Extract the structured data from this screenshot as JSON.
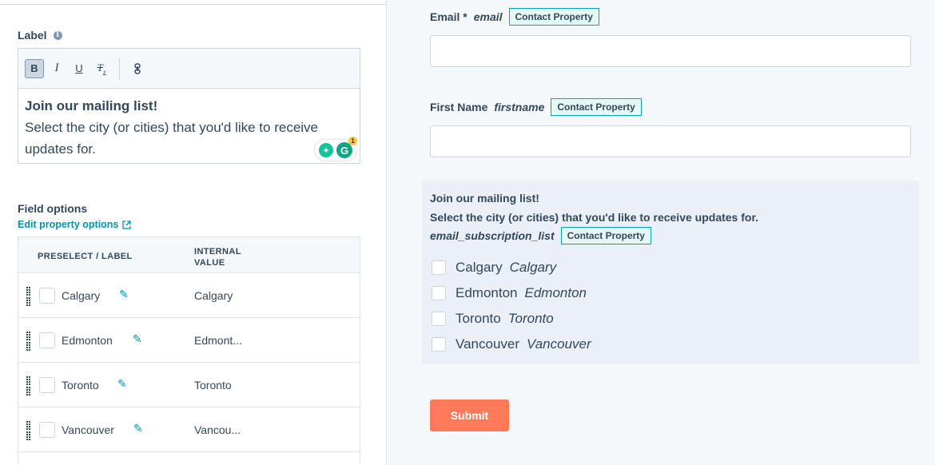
{
  "editor": {
    "label": "Label",
    "toolbar": {
      "bold": "B",
      "italic": "I",
      "underline": "U",
      "clear": "Tx",
      "link": "⛓"
    },
    "heading": "Join our mailing list!",
    "body": "Select the city (or cities) that you'd like to receive updates for.",
    "grammarly_count": "1"
  },
  "field_options": {
    "title": "Field options",
    "edit_link": "Edit property options",
    "columns": {
      "label": "PRESELECT / LABEL",
      "internal": "INTERNAL VALUE"
    },
    "rows": [
      {
        "label": "Calgary",
        "internal": "Calgary"
      },
      {
        "label": "Edmonton",
        "internal": "Edmont..."
      },
      {
        "label": "Toronto",
        "internal": "Toronto"
      },
      {
        "label": "Vancouver",
        "internal": "Vancou..."
      }
    ]
  },
  "preview": {
    "email": {
      "label": "Email *",
      "internal": "email",
      "tag": "Contact Property"
    },
    "firstname": {
      "label": "First Name",
      "internal": "firstname",
      "tag": "Contact Property"
    },
    "subscription": {
      "title": "Join our mailing list!",
      "description": "Select the city (or cities) that you'd like to receive updates for.",
      "internal": "email_subscription_list",
      "tag": "Contact Property",
      "options": [
        {
          "label": "Calgary",
          "internal": "Calgary"
        },
        {
          "label": "Edmonton",
          "internal": "Edmonton"
        },
        {
          "label": "Toronto",
          "internal": "Toronto"
        },
        {
          "label": "Vancouver",
          "internal": "Vancouver"
        }
      ]
    },
    "submit": "Submit"
  },
  "colors": {
    "accent": "#0091ae",
    "tag_border": "#00a4bd",
    "submit": "#ff7a59",
    "text": "#33475b"
  }
}
